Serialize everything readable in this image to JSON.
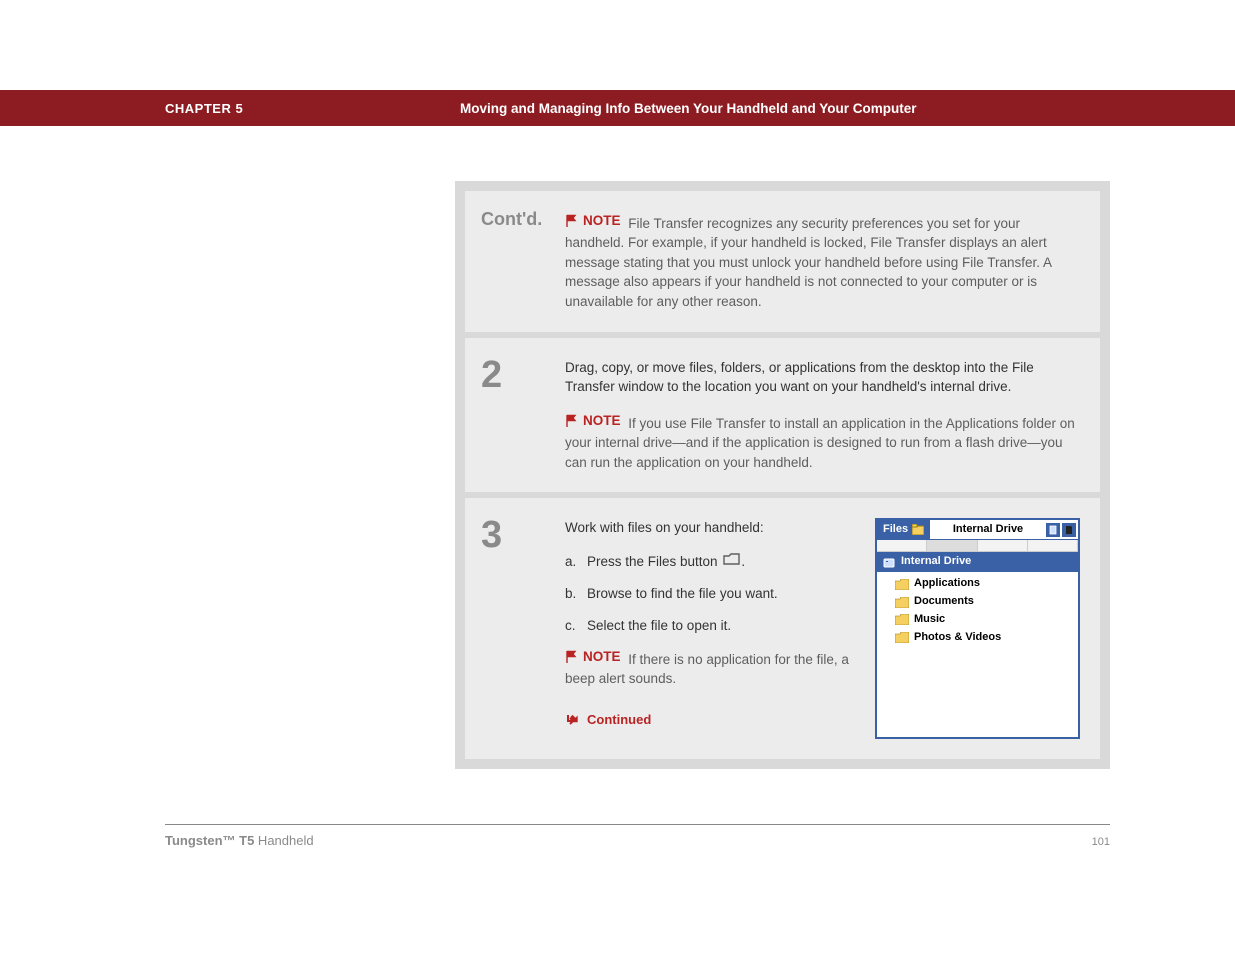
{
  "header": {
    "chapter_label": "CHAPTER 5",
    "chapter_title": "Moving and Managing Info Between Your Handheld and Your Computer"
  },
  "steps": {
    "contd": {
      "label": "Cont'd.",
      "note_label": "NOTE",
      "note_text": "File Transfer recognizes any security preferences you set for your handheld. For example, if your handheld is locked, File Transfer displays an alert message stating that you must unlock your handheld before using File Transfer. A message also appears if your handheld is not connected to your computer or is unavailable for any other reason."
    },
    "s2": {
      "num": "2",
      "intro": "Drag, copy, or move files, folders, or applications from the desktop into the File Transfer window to the location you want on your handheld's internal drive.",
      "note_label": "NOTE",
      "note_text": "If you use File Transfer to install an application in the Applications folder on your internal drive—and if the application is designed to run from a flash drive—you can run the application on your handheld."
    },
    "s3": {
      "num": "3",
      "intro": "Work with files on your handheld:",
      "a_marker": "a.",
      "a_text": "Press the Files button ",
      "a_tail": ".",
      "b_marker": "b.",
      "b_text": "Browse to find the file you want.",
      "c_marker": "c.",
      "c_text": "Select the file to open it.",
      "note_label": "NOTE",
      "note_text": "If there is no application for the file, a beep alert sounds.",
      "continued": "Continued"
    }
  },
  "pda": {
    "app_title": "Files",
    "drive_label": "Internal Drive",
    "crumb": "Internal Drive",
    "items": [
      "Applications",
      "Documents",
      "Music",
      "Photos & Videos"
    ]
  },
  "footer": {
    "product_bold": "Tungsten™ T5",
    "product_rest": " Handheld",
    "page": "101"
  }
}
